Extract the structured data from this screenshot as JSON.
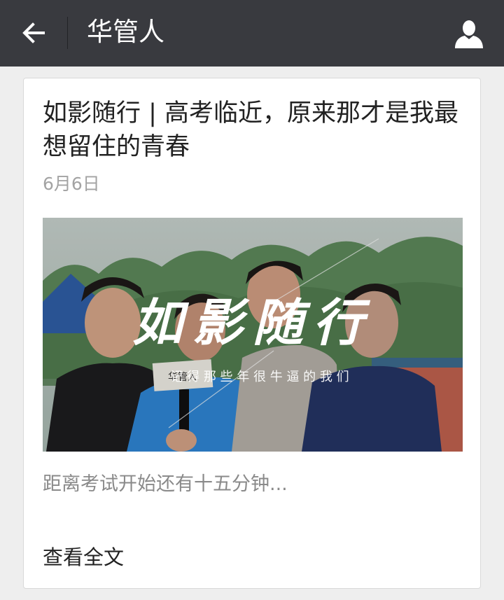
{
  "header": {
    "title": "华管人",
    "back_icon": "arrow-left-icon",
    "profile_icon": "person-icon",
    "background": "#393a3f"
  },
  "article": {
    "title": "如影随行 | 高考临近，原来那才是我最想留住的青春",
    "date": "6月6日",
    "cover": {
      "calligraphy": "如影随行",
      "tagline": "记 得 那 些 年 很 牛 逼 的 我 们",
      "mic_tag": "华管人"
    },
    "summary": "距离考试开始还有十五分钟...",
    "read_more": "查看全文"
  }
}
